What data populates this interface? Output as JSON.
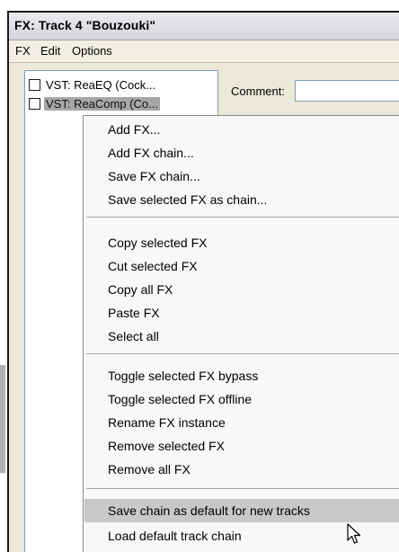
{
  "window": {
    "title": "FX: Track 4 \"Bouzouki\""
  },
  "menubar": {
    "items": [
      "FX",
      "Edit",
      "Options"
    ]
  },
  "fx_list": {
    "items": [
      {
        "label": "VST: ReaEQ (Cock...",
        "enabled": false
      },
      {
        "label": "VST: ReaComp (Co...",
        "enabled": false
      }
    ]
  },
  "comment": {
    "label": "Comment:",
    "value": ""
  },
  "context_menu": {
    "groups": [
      [
        "Add FX...",
        "Add FX chain...",
        "Save FX chain...",
        "Save selected FX as chain..."
      ],
      [
        "Copy selected FX",
        "Cut selected FX",
        "Copy all FX",
        "Paste FX",
        "Select all"
      ],
      [
        "Toggle selected FX bypass",
        "Toggle selected FX offline",
        "Rename FX instance",
        "Remove selected FX",
        "Remove all FX"
      ],
      [
        "Save chain as default for new tracks",
        "Load default track chain"
      ]
    ],
    "highlighted": "Save chain as default for new tracks"
  },
  "icons": {
    "cursor": "mouse-pointer-icon"
  }
}
